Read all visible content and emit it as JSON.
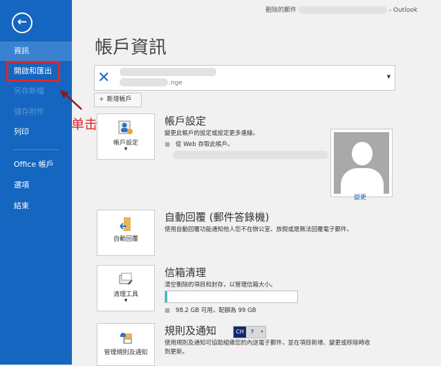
{
  "titlebar": {
    "text": "刪除的郵件",
    "app": "- Outlook"
  },
  "sidebar": {
    "items": [
      {
        "label": "資訊",
        "state": "selected"
      },
      {
        "label": "開啟和匯出",
        "state": "normal"
      },
      {
        "label": "另存新檔",
        "state": "disabled"
      },
      {
        "label": "儲存附件",
        "state": "disabled"
      },
      {
        "label": "列印",
        "state": "normal"
      },
      {
        "label": "Office 帳戶",
        "state": "normal"
      },
      {
        "label": "選項",
        "state": "normal"
      },
      {
        "label": "結束",
        "state": "normal"
      }
    ]
  },
  "annotation": {
    "text": "单击",
    "color": "#e0262a"
  },
  "page_title": "帳戶資訊",
  "account": {
    "type_suffix": ".nge"
  },
  "add_account": "新增帳戶",
  "sections": {
    "settings": {
      "tile": "帳戶設定",
      "title": "帳戶設定",
      "desc": "變更此帳戶的設定或設定更多連線。",
      "bullet": "從 Web 存取此帳戶。",
      "change": "變更"
    },
    "autoreply": {
      "tile": "自動回覆",
      "title": "自動回覆 (郵件答錄機)",
      "desc": "使用自動回覆功能通知他人您不在辦公室、放假或是無法回覆電子郵件。"
    },
    "cleanup": {
      "tile": "清理工具",
      "title": "信箱清理",
      "desc": "清空刪除的項目和封存，以管理信箱大小。",
      "usage": "98.2 GB 可用，配額為 99 GB",
      "used_fraction": 0.008
    },
    "rules": {
      "tile": "管理規則及通知",
      "title": "規則及通知",
      "desc1": "使用規則及通知可協助組織您的內送電子郵件，並在項目新增、變更或移除時收",
      "desc2": "到更新。"
    }
  },
  "ime": {
    "lang": "CH",
    "help": "?"
  },
  "colors": {
    "sidebar": "#1466c0",
    "accent": "#3eb5d8"
  }
}
